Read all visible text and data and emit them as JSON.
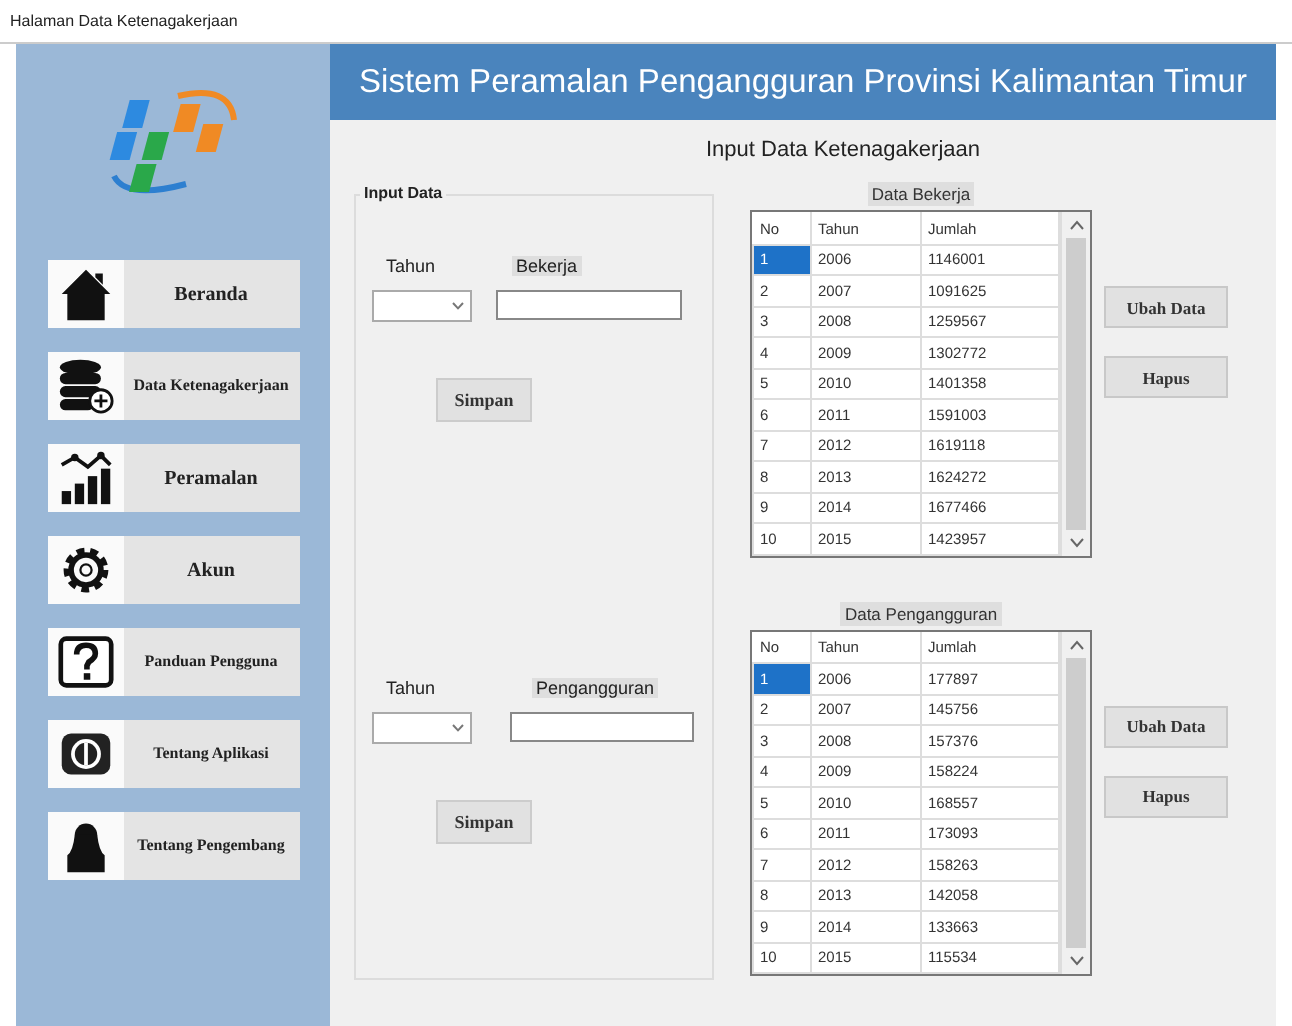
{
  "window": {
    "title": "Halaman Data Ketenagakerjaan"
  },
  "sidebar": {
    "items": [
      {
        "kind": "home",
        "label": "Beranda"
      },
      {
        "kind": "database",
        "label": "Data Ketenagakerjaan"
      },
      {
        "kind": "chart",
        "label": "Peramalan"
      },
      {
        "kind": "gear",
        "label": "Akun"
      },
      {
        "kind": "help",
        "label": "Panduan Pengguna"
      },
      {
        "kind": "info",
        "label": "Tentang Aplikasi"
      },
      {
        "kind": "person",
        "label": "Tentang Pengembang"
      }
    ]
  },
  "header": {
    "title": "Sistem Peramalan Pengangguran Provinsi Kalimantan Timur"
  },
  "subtitle": "Input Data Ketenagakerjaan",
  "input_group": {
    "title": "Input Data",
    "forms": [
      {
        "year_label": "Tahun",
        "value_label": "Bekerja",
        "button": "Simpan"
      },
      {
        "year_label": "Tahun",
        "value_label": "Pengangguran",
        "button": "Simpan"
      }
    ]
  },
  "tables": [
    {
      "title": "Data Bekerja",
      "columns": [
        "No",
        "Tahun",
        "Jumlah"
      ],
      "rows": [
        {
          "cells": [
            "1",
            "2006",
            "1146001"
          ],
          "selected": true
        },
        {
          "cells": [
            "2",
            "2007",
            "1091625"
          ],
          "selected": false
        },
        {
          "cells": [
            "3",
            "2008",
            "1259567"
          ],
          "selected": false
        },
        {
          "cells": [
            "4",
            "2009",
            "1302772"
          ],
          "selected": false
        },
        {
          "cells": [
            "5",
            "2010",
            "1401358"
          ],
          "selected": false
        },
        {
          "cells": [
            "6",
            "2011",
            "1591003"
          ],
          "selected": false
        },
        {
          "cells": [
            "7",
            "2012",
            "1619118"
          ],
          "selected": false
        },
        {
          "cells": [
            "8",
            "2013",
            "1624272"
          ],
          "selected": false
        },
        {
          "cells": [
            "9",
            "2014",
            "1677466"
          ],
          "selected": false
        },
        {
          "cells": [
            "10",
            "2015",
            "1423957"
          ],
          "selected": false
        }
      ],
      "buttons": [
        "Ubah Data",
        "Hapus"
      ]
    },
    {
      "title": "Data Pengangguran",
      "columns": [
        "No",
        "Tahun",
        "Jumlah"
      ],
      "rows": [
        {
          "cells": [
            "1",
            "2006",
            "177897"
          ],
          "selected": true
        },
        {
          "cells": [
            "2",
            "2007",
            "145756"
          ],
          "selected": false
        },
        {
          "cells": [
            "3",
            "2008",
            "157376"
          ],
          "selected": false
        },
        {
          "cells": [
            "4",
            "2009",
            "158224"
          ],
          "selected": false
        },
        {
          "cells": [
            "5",
            "2010",
            "168557"
          ],
          "selected": false
        },
        {
          "cells": [
            "6",
            "2011",
            "173093"
          ],
          "selected": false
        },
        {
          "cells": [
            "7",
            "2012",
            "158263"
          ],
          "selected": false
        },
        {
          "cells": [
            "8",
            "2013",
            "142058"
          ],
          "selected": false
        },
        {
          "cells": [
            "9",
            "2014",
            "133663"
          ],
          "selected": false
        },
        {
          "cells": [
            "10",
            "2015",
            "115534"
          ],
          "selected": false
        }
      ],
      "buttons": [
        "Ubah Data",
        "Hapus"
      ]
    }
  ]
}
